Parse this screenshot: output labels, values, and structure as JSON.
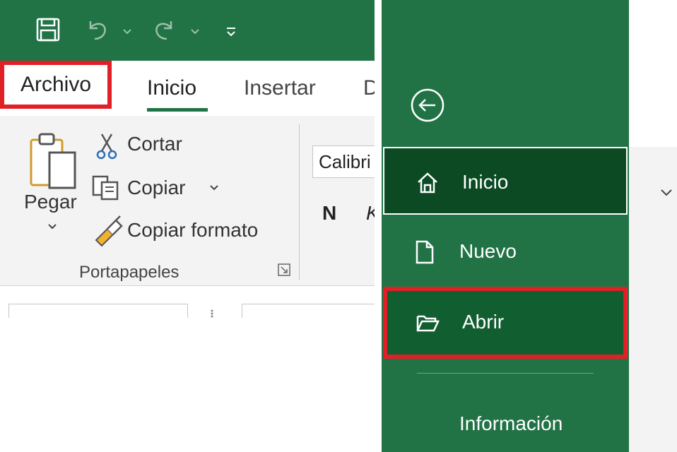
{
  "ribbon": {
    "tabs": {
      "archivo": "Archivo",
      "inicio": "Inicio",
      "insertar": "Insertar",
      "next_partial": "D"
    },
    "clipboard": {
      "paste_label": "Pegar",
      "cut_label": "Cortar",
      "copy_label": "Copiar",
      "format_painter_label": "Copiar formato",
      "group_label": "Portapapeles"
    },
    "font": {
      "font_name": "Calibri",
      "bold_label": "N",
      "italic_label": "K"
    }
  },
  "backstage": {
    "items": [
      {
        "label": "Inicio",
        "icon": "home-icon",
        "state": "selected"
      },
      {
        "label": "Nuevo",
        "icon": "new-document-icon",
        "state": "normal"
      },
      {
        "label": "Abrir",
        "icon": "open-folder-icon",
        "state": "highlighted"
      }
    ],
    "info_label": "Información"
  },
  "colors": {
    "excel_green": "#217346",
    "selected_green": "#0b4a23",
    "highlight_red": "#e11f26",
    "ribbon_bg": "#f3f3f3"
  }
}
